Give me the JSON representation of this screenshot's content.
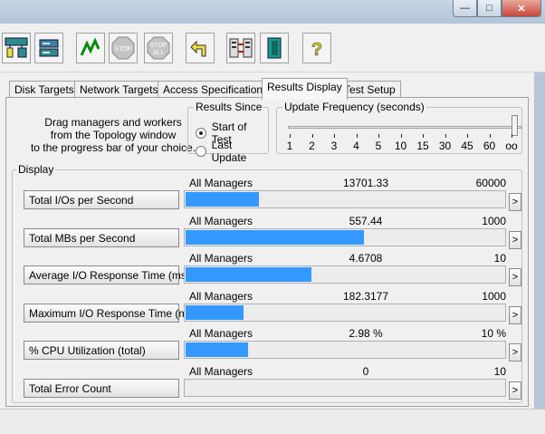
{
  "toolbar": {
    "buttons": [
      {
        "name": "topology-icon"
      },
      {
        "name": "disk-worker-icon"
      },
      {
        "name": "start-icon"
      },
      {
        "name": "stop-icon",
        "label": "STOP"
      },
      {
        "name": "stop-all-icon",
        "label": "STOP",
        "label2": "ALL"
      },
      {
        "name": "reset-icon"
      },
      {
        "name": "network-worker-icon"
      },
      {
        "name": "exit-icon"
      },
      {
        "name": "help-icon",
        "label": "?"
      }
    ]
  },
  "tabs": [
    "Disk Targets",
    "Network Targets",
    "Access Specifications",
    "Results Display",
    "Test Setup"
  ],
  "instructions": [
    "Drag managers and workers",
    "from the Topology window",
    "to the progress bar of your choice."
  ],
  "results_since": {
    "title": "Results Since",
    "options": [
      "Start of Test",
      "Last Update"
    ],
    "selected": "Start of Test"
  },
  "update_frequency": {
    "title": "Update Frequency (seconds)",
    "ticks": [
      "1",
      "2",
      "3",
      "4",
      "5",
      "10",
      "15",
      "30",
      "45",
      "60",
      "oo"
    ],
    "selected_index": 10
  },
  "display": {
    "title": "Display",
    "rows": [
      {
        "label": "Total I/Os per Second",
        "source": "All Managers",
        "value": "13701.33",
        "max": "60000",
        "fill": 0.228
      },
      {
        "label": "Total MBs per Second",
        "source": "All Managers",
        "value": "557.44",
        "max": "1000",
        "fill": 0.557
      },
      {
        "label": "Average I/O Response Time (ms)",
        "source": "All Managers",
        "value": "4.6708",
        "max": "10",
        "fill": 0.394
      },
      {
        "label": "Maximum I/O Response Time (ms)",
        "source": "All Managers",
        "value": "182.3177",
        "max": "1000",
        "fill": 0.182
      },
      {
        "label": "% CPU Utilization (total)",
        "source": "All Managers",
        "value": "2.98 %",
        "max": "10 %",
        "fill": 0.196
      },
      {
        "label": "Total Error Count",
        "source": "All Managers",
        "value": "0",
        "max": "10",
        "fill": 0
      }
    ],
    "arrow": ">"
  },
  "colors": {
    "bar": "#3399ff"
  }
}
